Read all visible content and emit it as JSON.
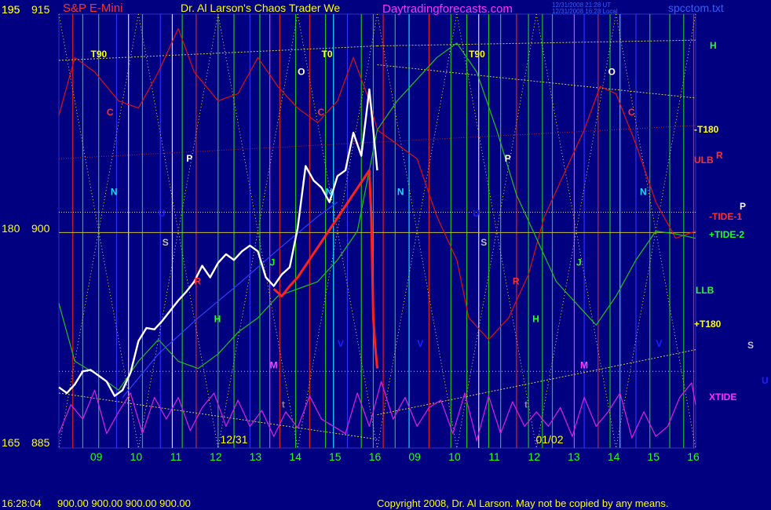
{
  "header": {
    "left_label": "195",
    "left_price": "915",
    "symbol": "S&P E-Mini",
    "title": "Dr. Al Larson's Chaos Trader We",
    "site": "Daytradingforecasts.com",
    "stamp_ut": "12/31/2008 21:28 UT",
    "stamp_local": "12/31/2008 16:28 Local",
    "filename": "spcctom.txt"
  },
  "footer": {
    "time": "16:28:04",
    "ohlc": "900.00 900.00 900.00 900.00",
    "copyright": "Copyright 2008, Dr. Al Larson. May not be copied by any means."
  },
  "colors": {
    "background": "#000080",
    "price_bars": "#ffffff",
    "ulb": "#e01010",
    "llb": "#20c020",
    "xtide": "#e020e0",
    "grid": "#d8d040",
    "axis_labels": "#ffff00"
  },
  "chart_data": {
    "type": "line",
    "title": "S&P E-Mini",
    "y_axis": {
      "left_labels": [
        "195",
        "180",
        "165"
      ],
      "right_prices": [
        "915",
        "900",
        "885"
      ],
      "price_range": [
        885,
        915
      ]
    },
    "x_axis": {
      "ticks": [
        "09",
        "10",
        "11",
        "12",
        "13",
        "14",
        "15",
        "16",
        "09",
        "10",
        "11",
        "12",
        "13",
        "14",
        "15",
        "16"
      ],
      "dates": [
        "12/31",
        "01/02"
      ]
    },
    "time_labels": [
      "T90",
      "T0",
      "T90"
    ],
    "right_labels": [
      "H",
      "-T180",
      "ULB",
      "R",
      "P",
      "-TIDE-1",
      "+TIDE-2",
      "LLB",
      "+T180",
      "S",
      "U",
      "XTIDE"
    ],
    "markers": [
      {
        "label": "C",
        "color": "#ff3030",
        "x": 9.2,
        "y": 908
      },
      {
        "label": "N",
        "color": "#20d8ff",
        "x": 9.3,
        "y": 902.5
      },
      {
        "label": "U",
        "color": "#2020ff",
        "x": 10.5,
        "y": 901
      },
      {
        "label": "S",
        "color": "#c0c0c0",
        "x": 10.6,
        "y": 899
      },
      {
        "label": "P",
        "color": "#ffffff",
        "x": 11.2,
        "y": 904.8
      },
      {
        "label": "R",
        "color": "#ff3030",
        "x": 11.4,
        "y": 896.3
      },
      {
        "label": "H",
        "color": "#20ff20",
        "x": 11.9,
        "y": 893.7
      },
      {
        "label": "J",
        "color": "#20ff20",
        "x": 13.3,
        "y": 897.6
      },
      {
        "label": "M",
        "color": "#ff40ff",
        "x": 13.3,
        "y": 890.5
      },
      {
        "label": "t",
        "color": "#909090",
        "x": 13.6,
        "y": 887.8
      },
      {
        "label": "O",
        "color": "#ffffff",
        "x": 14.0,
        "y": 910.8
      },
      {
        "label": "C",
        "color": "#ff3030",
        "x": 14.5,
        "y": 908
      },
      {
        "label": "N",
        "color": "#20d8ff",
        "x": 14.7,
        "y": 902.5
      },
      {
        "label": "V",
        "color": "#2020ff",
        "x": 15.0,
        "y": 892
      },
      {
        "label": "N",
        "color": "#20d8ff",
        "x": 16.5,
        "y": 902.5
      },
      {
        "label": "V",
        "color": "#2020ff",
        "x": 17.0,
        "y": 892
      },
      {
        "label": "U",
        "color": "#2020ff",
        "x": 18.4,
        "y": 901
      },
      {
        "label": "S",
        "color": "#c0c0c0",
        "x": 18.6,
        "y": 899
      },
      {
        "label": "P",
        "color": "#ffffff",
        "x": 19.2,
        "y": 904.8
      },
      {
        "label": "R",
        "color": "#ff3030",
        "x": 19.4,
        "y": 896.3
      },
      {
        "label": "t",
        "color": "#909090",
        "x": 19.7,
        "y": 887.8
      },
      {
        "label": "H",
        "color": "#20ff20",
        "x": 19.9,
        "y": 893.7
      },
      {
        "label": "J",
        "color": "#20ff20",
        "x": 21.0,
        "y": 897.6
      },
      {
        "label": "M",
        "color": "#ff40ff",
        "x": 21.1,
        "y": 890.5
      },
      {
        "label": "O",
        "color": "#ffffff",
        "x": 21.8,
        "y": 910.8
      },
      {
        "label": "C",
        "color": "#ff3030",
        "x": 22.3,
        "y": 908
      },
      {
        "label": "N",
        "color": "#20d8ff",
        "x": 22.6,
        "y": 902.5
      },
      {
        "label": "V",
        "color": "#2020ff",
        "x": 23.0,
        "y": 892
      }
    ],
    "series": [
      {
        "name": "ULB",
        "color": "#e01010",
        "x": [
          8.0,
          8.4,
          8.9,
          9.5,
          10.0,
          10.5,
          11.0,
          11.4,
          12.0,
          12.5,
          13.0,
          13.5,
          14.0,
          14.5,
          15.0,
          15.4,
          15.8,
          16.0,
          16.5,
          17.0,
          17.5,
          18.0,
          18.3,
          18.8,
          19.3,
          19.8,
          20.2,
          20.7,
          21.2,
          21.6,
          22.0,
          22.5,
          23.0,
          23.5,
          24.0
        ],
        "y": [
          908,
          912,
          911,
          909,
          908.5,
          911,
          914,
          911,
          909,
          909.5,
          912,
          910,
          908.5,
          907.5,
          909,
          912,
          909,
          907,
          906,
          905,
          901,
          898,
          894,
          892.5,
          894,
          897,
          901,
          904,
          907,
          910,
          909.5,
          906,
          902,
          899.5,
          900
        ]
      },
      {
        "name": "LLB",
        "color": "#20c020",
        "x": [
          8.0,
          8.4,
          9.0,
          9.5,
          10.0,
          10.5,
          11.0,
          11.5,
          12.0,
          12.5,
          13.0,
          13.5,
          14.0,
          14.5,
          15.0,
          15.5,
          16.0,
          16.5,
          17.0,
          17.5,
          18.0,
          18.5,
          19.0,
          19.5,
          20.0,
          20.5,
          21.0,
          21.5,
          22.0,
          22.5,
          23.0,
          23.5,
          24.0
        ],
        "y": [
          895,
          891,
          890,
          889,
          891,
          892.5,
          891,
          890.5,
          891.5,
          893,
          894,
          895.5,
          896,
          896.5,
          898,
          900,
          907,
          909,
          910.5,
          912,
          913,
          911,
          907,
          902.5,
          899.5,
          896.5,
          895,
          893.5,
          895.5,
          898,
          900,
          899.8,
          899.5
        ]
      },
      {
        "name": "Trend",
        "color": "#3040ff",
        "x": [
          9.6,
          10.5,
          11.5,
          12.5,
          13.5,
          14.5,
          15.0
        ],
        "y": [
          888.5,
          891.5,
          894,
          896.3,
          898.7,
          901,
          902
        ]
      },
      {
        "name": "XTIDE",
        "color": "#e020e0",
        "x": [
          8.0,
          8.3,
          8.6,
          8.9,
          9.2,
          9.5,
          9.8,
          10.1,
          10.4,
          10.7,
          11.0,
          11.3,
          11.6,
          11.9,
          12.2,
          12.5,
          12.8,
          13.1,
          13.4,
          13.7,
          14.0,
          14.3,
          14.6,
          14.9,
          15.2,
          15.5,
          15.8,
          16.1,
          16.4,
          16.7,
          17.0,
          17.3,
          17.6,
          17.9,
          18.2,
          18.5,
          18.8,
          19.1,
          19.4,
          19.7,
          20.0,
          20.3,
          20.6,
          20.9,
          21.2,
          21.5,
          21.8,
          22.1,
          22.4,
          22.7,
          23.0,
          23.3,
          23.6,
          23.9,
          24.0
        ],
        "y": [
          886,
          888,
          887,
          889,
          886,
          887.5,
          888.8,
          886,
          888.5,
          887,
          888.5,
          886.2,
          887.8,
          888.8,
          886.5,
          888.3,
          886.5,
          887.6,
          885.8,
          887.5,
          886.4,
          888.6,
          887,
          886.5,
          886,
          888.8,
          886.5,
          889.6,
          887,
          888.5,
          886.5,
          887.8,
          888.3,
          886,
          888.8,
          885.5,
          888.6,
          886,
          888.2,
          886.5,
          887.5,
          886.5,
          887.8,
          885.8,
          888.5,
          886.5,
          887.5,
          888.8,
          885.7,
          887.5,
          885.8,
          886.5,
          888.5,
          889.5,
          888
        ]
      },
      {
        "name": "Price",
        "color": "#ffffff",
        "x": [
          8.0,
          8.2,
          8.4,
          8.6,
          8.8,
          9.0,
          9.2,
          9.4,
          9.6,
          9.8,
          10.0,
          10.2,
          10.4,
          10.6,
          10.8,
          11.0,
          11.2,
          11.4,
          11.6,
          11.8,
          12.0,
          12.2,
          12.4,
          12.6,
          12.8,
          13.0,
          13.2,
          13.4,
          13.6,
          13.8,
          14.0,
          14.2,
          14.4,
          14.6,
          14.8,
          15.0,
          15.2,
          15.4,
          15.6,
          15.8,
          16.0
        ],
        "y": [
          889.2,
          888.8,
          889.4,
          890.3,
          890.4,
          890.0,
          889.6,
          888.6,
          889.0,
          890.2,
          892.4,
          893.3,
          893.2,
          893.8,
          894.5,
          895.2,
          895.8,
          896.5,
          897.6,
          896.8,
          897.8,
          898.4,
          898.0,
          898.6,
          899.0,
          898.6,
          896.8,
          896.2,
          897.0,
          897.5,
          900.2,
          904.5,
          903.5,
          903.0,
          902.0,
          903.8,
          904.2,
          906.8,
          905.2,
          909.8,
          904.2
        ]
      },
      {
        "name": "Drop",
        "color": "#ff2020",
        "x": [
          13.4,
          13.6,
          13.8,
          14.0,
          15.8,
          15.85,
          15.9,
          15.95,
          16.0
        ],
        "y": [
          896.0,
          895.5,
          896.2,
          896.8,
          904.2,
          901.0,
          894.0,
          892.0,
          890.5
        ]
      }
    ]
  }
}
